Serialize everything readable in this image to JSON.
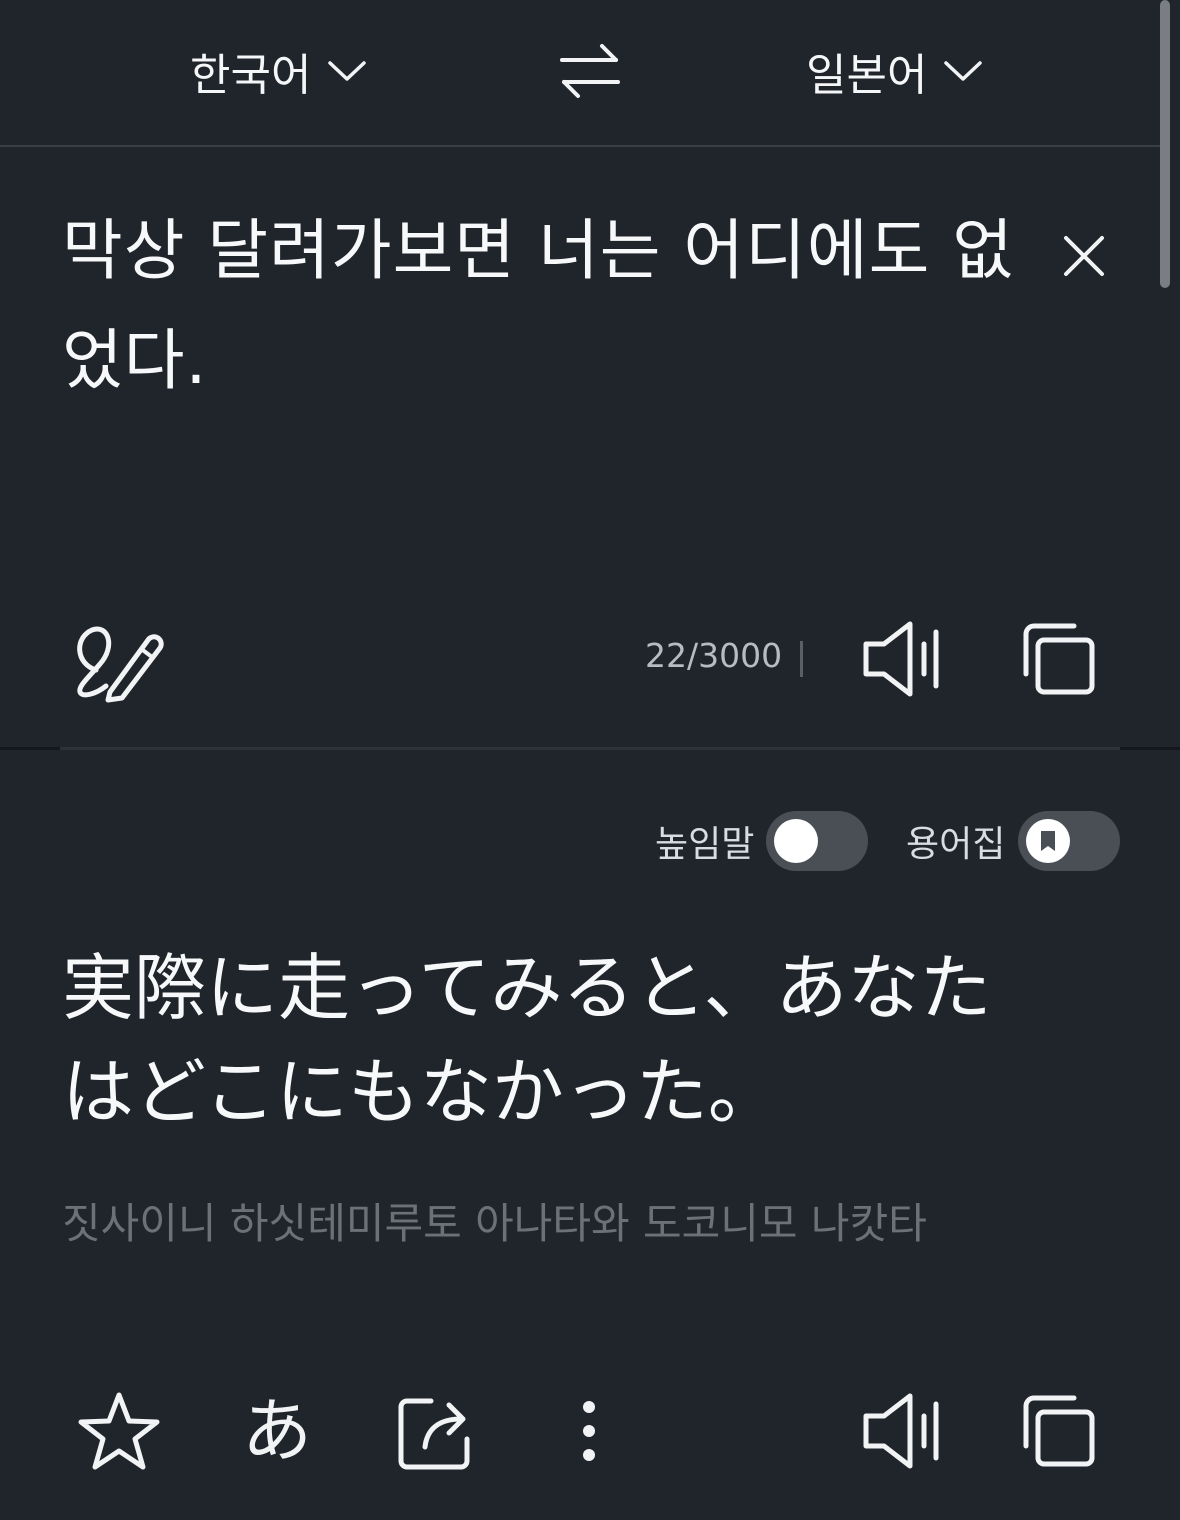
{
  "languages": {
    "source": "한국어",
    "target": "일본어"
  },
  "source": {
    "text": "막상 달려가보면 너는 어디에도 없었다.",
    "char_count": "22/3000"
  },
  "target": {
    "text": "実際に走ってみると、あなたはどこにもなかった。",
    "pronunciation": "짓사이니 하싯테미루토 아나타와 도코니모 나캇타"
  },
  "toggles": {
    "honorific_label": "높임말",
    "honorific_on": false,
    "glossary_label": "용어집",
    "glossary_on": false
  },
  "bottom_toolbar": {
    "kana_label": "あ"
  },
  "colors": {
    "background": "#20252c",
    "text": "#f2f3f5",
    "muted": "#6c7178",
    "toggle_track": "#4a4f56"
  }
}
